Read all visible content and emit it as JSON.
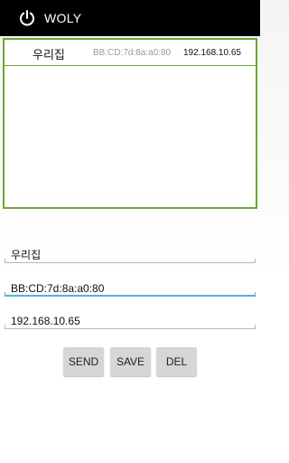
{
  "action_bar": {
    "icon": "power-icon",
    "title": "WOLY"
  },
  "device_list": {
    "items": [
      {
        "name": "우리집",
        "mac": "BB:CD:7d:8a:a0:80",
        "ip": "192.168.10.65"
      }
    ]
  },
  "form": {
    "name_value": "우리집",
    "mac_value": "BB:CD:7d:8a:a0:80",
    "ip_value": "192.168.10.65"
  },
  "buttons": {
    "send_label": "SEND",
    "save_label": "SAVE",
    "del_label": "DEL"
  },
  "colors": {
    "action_bar": "#000000",
    "list_border": "#6aa82f",
    "focus": "#5aaee0",
    "button": "#d6d6d6"
  }
}
